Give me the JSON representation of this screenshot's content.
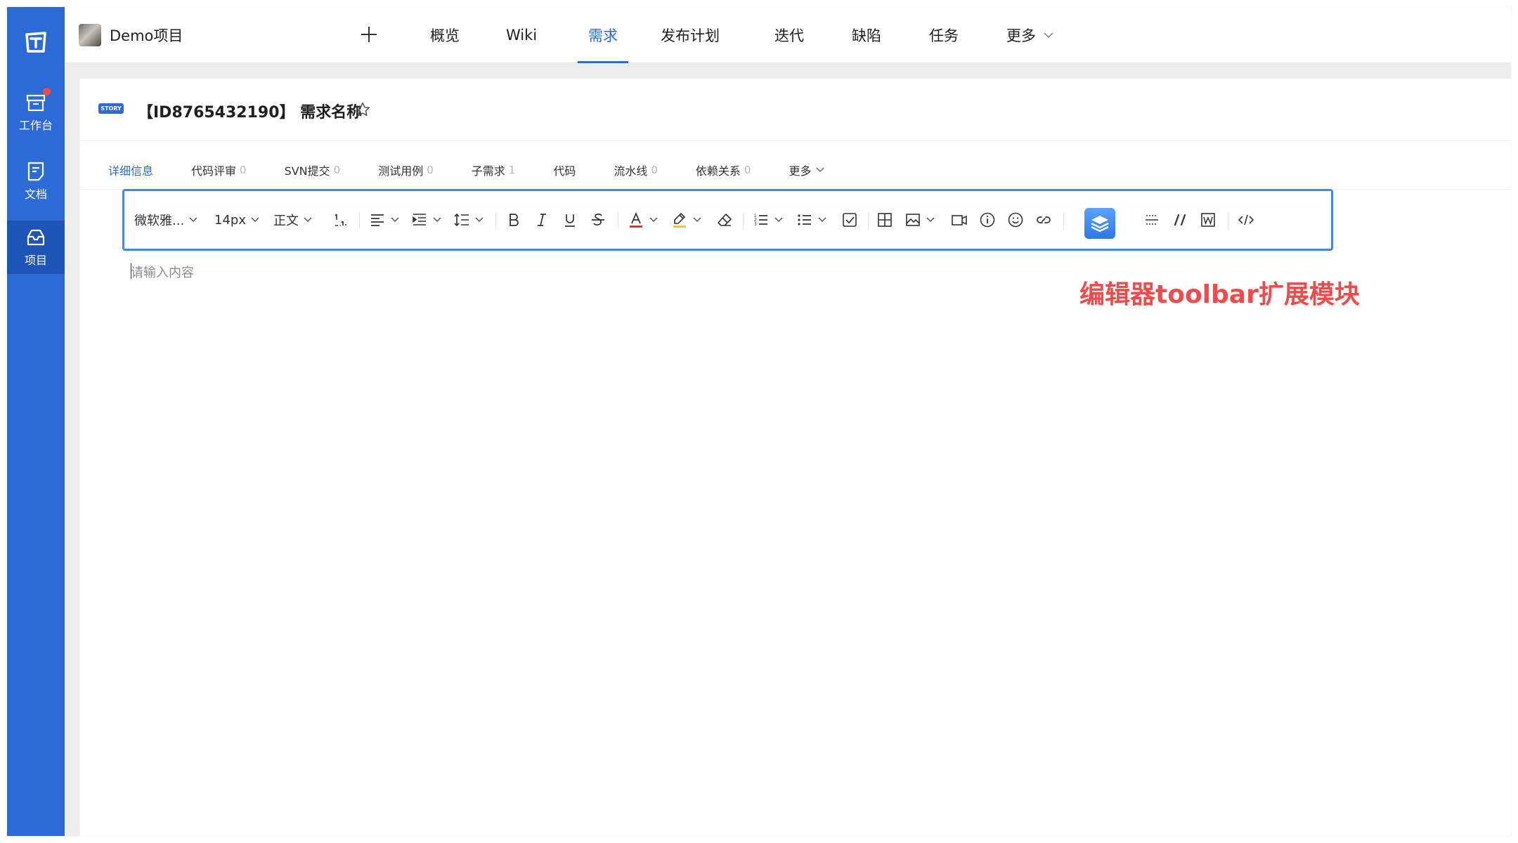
{
  "project": {
    "name": "Demo项目"
  },
  "rail": {
    "items": [
      {
        "label": "工作台",
        "icon": "workbench-icon",
        "badge": true
      },
      {
        "label": "文档",
        "icon": "document-icon"
      },
      {
        "label": "项目",
        "icon": "project-icon",
        "active": true
      }
    ]
  },
  "topnav": {
    "items": [
      {
        "label": "概览"
      },
      {
        "label": "Wiki"
      },
      {
        "label": "需求",
        "active": true
      },
      {
        "label": "发布计划"
      },
      {
        "label": "迭代"
      },
      {
        "label": "缺陷"
      },
      {
        "label": "任务"
      },
      {
        "label": "更多"
      }
    ]
  },
  "story": {
    "badge": "STORY",
    "title": "【ID8765432190】 需求名称"
  },
  "subtabs": [
    {
      "label": "详细信息",
      "count": "",
      "active": true
    },
    {
      "label": "代码评审",
      "count": "0"
    },
    {
      "label": "SVN提交",
      "count": "0"
    },
    {
      "label": "测试用例",
      "count": "0"
    },
    {
      "label": "子需求",
      "count": "1"
    },
    {
      "label": "代码",
      "count": ""
    },
    {
      "label": "流水线",
      "count": "0"
    },
    {
      "label": "依赖关系",
      "count": "0"
    },
    {
      "label": "更多",
      "count": ""
    }
  ],
  "toolbar": {
    "font_family": "微软雅...",
    "font_size": "14px",
    "paragraph": "正文",
    "icons": [
      "line-height-icon",
      "align-left-icon",
      "indent-icon",
      "paragraph-spacing-icon",
      "bold-icon",
      "italic-icon",
      "underline-icon",
      "strikethrough-icon",
      "font-color-icon",
      "highlight-icon",
      "eraser-icon",
      "ordered-list-icon",
      "bullet-list-icon",
      "checklist-icon",
      "table-icon",
      "image-icon",
      "video-icon",
      "info-icon",
      "emoji-icon",
      "link-icon",
      "extension-layers-icon",
      "divider-icon",
      "quote-icon",
      "word-import-icon",
      "code-icon"
    ]
  },
  "editor": {
    "placeholder": "请输入内容"
  },
  "annotation": "编辑器toolbar扩展模块",
  "colors": {
    "brand": "#2c6ad6",
    "annotation": "#ef4b4b",
    "font_color_underline": "#e5322d",
    "highlight_underline": "#f5c518"
  }
}
